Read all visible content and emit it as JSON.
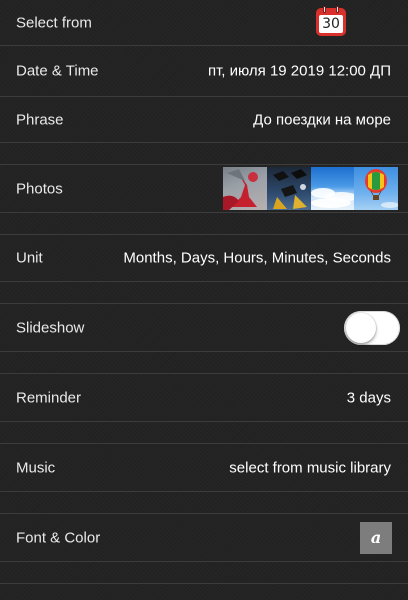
{
  "settings": {
    "select_from": {
      "label": "Select from",
      "calendar_day": "30",
      "icon": "calendar-icon"
    },
    "date_time": {
      "label": "Date & Time",
      "value": "пт, июля 19 2019 12:00 ДП"
    },
    "phrase": {
      "label": "Phrase",
      "value": "До поездки на море"
    },
    "photos": {
      "label": "Photos",
      "thumbnails": [
        "photo-red-dress",
        "photo-graduation-caps",
        "photo-sky-clouds",
        "photo-hot-air-balloon"
      ]
    },
    "unit": {
      "label": "Unit",
      "value": "Months, Days, Hours, Minutes, Seconds"
    },
    "slideshow": {
      "label": "Slideshow",
      "enabled": false
    },
    "reminder": {
      "label": "Reminder",
      "value": "3 days"
    },
    "music": {
      "label": "Music",
      "value": "select from music library"
    },
    "font_color": {
      "label": "Font & Color",
      "swatch_glyph": "a",
      "swatch_color": "#7d7d7d"
    }
  },
  "colors": {
    "background": "#232323",
    "separator": "#3c3c3c",
    "calendar_red": "#d8302c"
  }
}
